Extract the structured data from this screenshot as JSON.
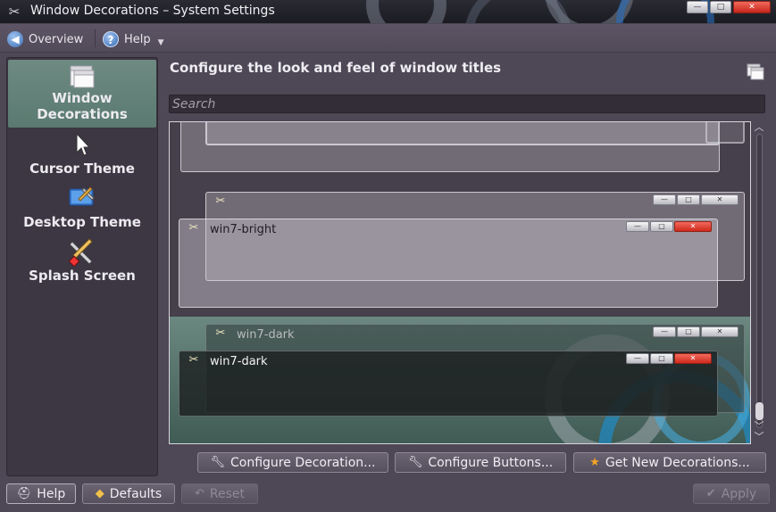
{
  "window": {
    "title": "Window Decorations – System Settings",
    "buttons": {
      "minimize": "—",
      "maximize": "□",
      "close": "✕"
    }
  },
  "toolbar": {
    "overview_label": "Overview",
    "help_label": "Help"
  },
  "sidebar": {
    "items": [
      {
        "label_line1": "Window",
        "label_line2": "Decorations",
        "icon": "window-icon",
        "selected": true
      },
      {
        "label": "Cursor Theme",
        "icon": "cursor-icon",
        "selected": false
      },
      {
        "label": "Desktop Theme",
        "icon": "desktop-theme-icon",
        "selected": false
      },
      {
        "label": "Splash Screen",
        "icon": "splash-screen-icon",
        "selected": false
      }
    ]
  },
  "main": {
    "title": "Configure the look and feel of window titles",
    "search_placeholder": "Search",
    "decorations": [
      {
        "name": "win7-bright",
        "style": "bright"
      },
      {
        "name": "win7-dark",
        "style": "dark"
      }
    ]
  },
  "actions": {
    "configure_decoration": "Configure Decoration...",
    "configure_buttons": "Configure Buttons...",
    "get_new_decorations": "Get New Decorations..."
  },
  "footer": {
    "help": "Help",
    "defaults": "Defaults",
    "reset": "Reset",
    "apply": "Apply"
  },
  "colors": {
    "background": "#4e4756",
    "sidebar": "#3d3643",
    "selection": "#6e8a82",
    "close_button": "#c8261a"
  }
}
